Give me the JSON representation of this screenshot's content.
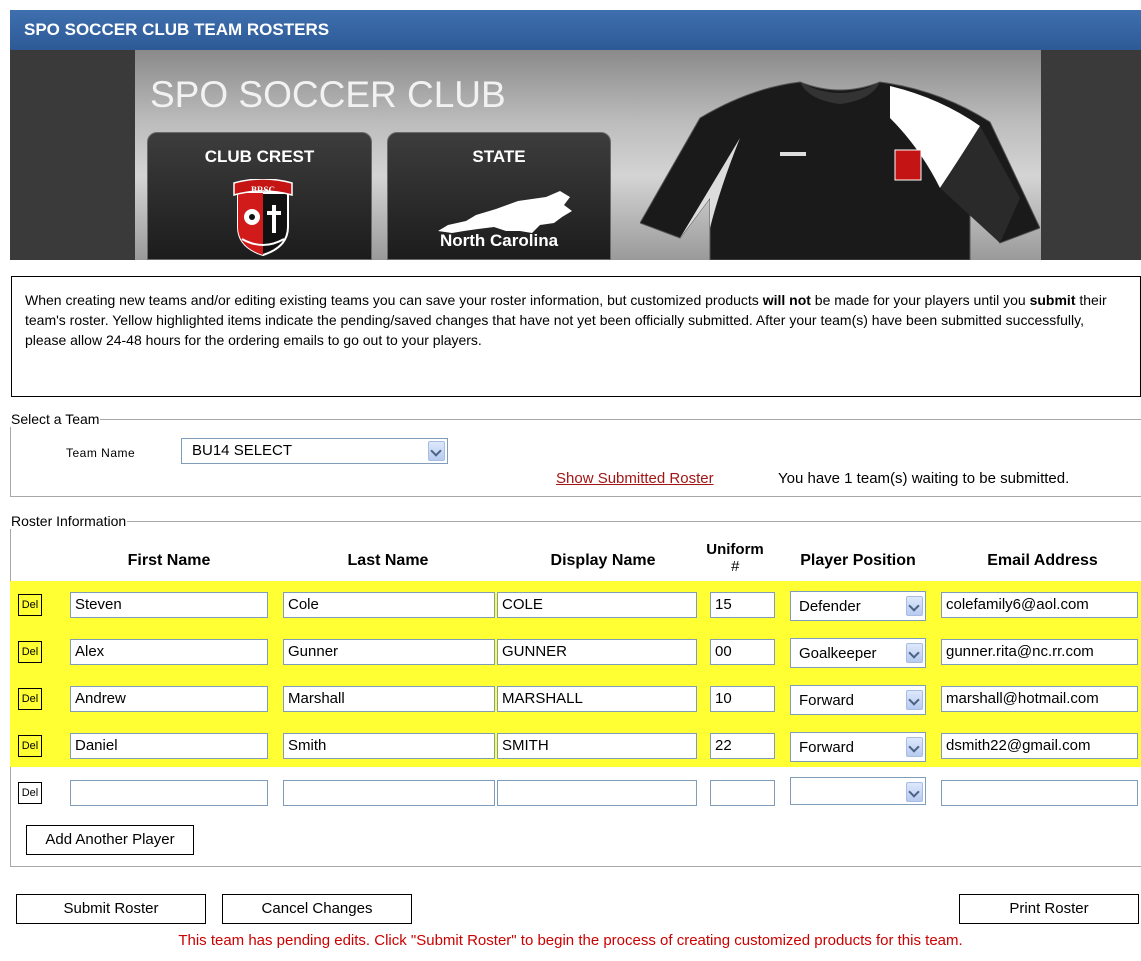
{
  "header": {
    "title": "SPO SOCCER CLUB TEAM ROSTERS"
  },
  "banner": {
    "club_name": "SPO SOCCER CLUB",
    "crest_label": "CLUB CREST",
    "state_label": "STATE",
    "state_name": "North Carolina",
    "crest_text": "BRSC"
  },
  "notice": {
    "p1": "When creating new teams and/or editing existing teams you can save your roster information, but customized products ",
    "b1": "will not",
    "p2": " be made for your players until you ",
    "b2": "submit",
    "p3": " their team's roster. Yellow highlighted items indicate the pending/saved changes that have not yet been officially submitted. After your team(s) have been submitted successfully, please allow 24-48 hours for the ordering emails to go out to your players."
  },
  "team_select": {
    "legend": "Select a Team",
    "label": "Team Name",
    "value": "BU14 SELECT",
    "show_link": "Show Submitted Roster",
    "waiting": "You have 1 team(s) waiting to be submitted."
  },
  "roster": {
    "legend": "Roster Information",
    "headers": {
      "first": "First Name",
      "last": "Last Name",
      "display": "Display Name",
      "uniform_1": "Uniform",
      "uniform_2": "#",
      "position": "Player Position",
      "email": "Email Address"
    },
    "del_label": "Del",
    "players": [
      {
        "first": "Steven",
        "last": "Cole",
        "display": "COLE",
        "uniform": "15",
        "position": "Defender",
        "email": "colefamily6@aol.com"
      },
      {
        "first": "Alex",
        "last": "Gunner",
        "display": "GUNNER",
        "uniform": "00",
        "position": "Goalkeeper",
        "email": "gunner.rita@nc.rr.com"
      },
      {
        "first": "Andrew",
        "last": "Marshall",
        "display": "MARSHALL",
        "uniform": "10",
        "position": "Forward",
        "email": "marshall@hotmail.com"
      },
      {
        "first": "Daniel",
        "last": "Smith",
        "display": "SMITH",
        "uniform": "22",
        "position": "Forward",
        "email": "dsmith22@gmail.com"
      }
    ],
    "add_button": "Add Another Player"
  },
  "actions": {
    "submit": "Submit Roster",
    "cancel": "Cancel Changes",
    "print": "Print Roster"
  },
  "pending_message": "This team has pending edits. Click \"Submit Roster\" to begin the process of creating customized products for this team.",
  "colors": {
    "title_bar": "#2d5a97",
    "highlight": "#ffff33",
    "link": "#a31515",
    "pending": "#cc0000"
  }
}
